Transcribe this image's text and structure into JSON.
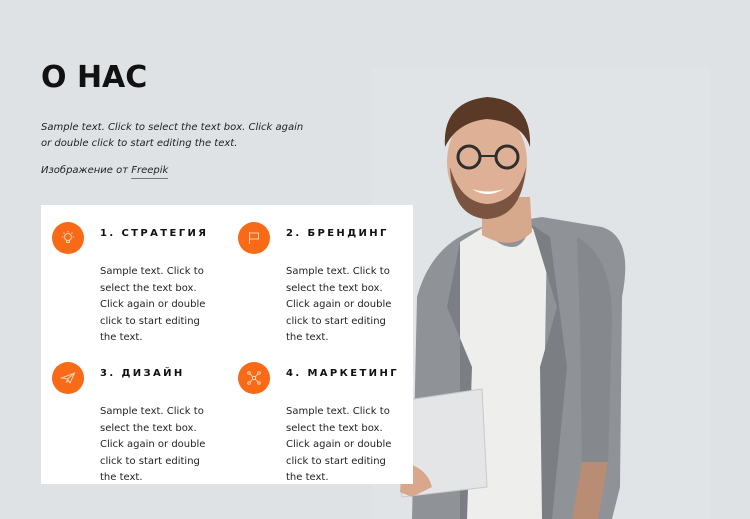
{
  "header": {
    "title": "О НАС",
    "intro": "Sample text. Click to select the text box. Click again or double click to start editing the text.",
    "credit_prefix": "Изображение от ",
    "credit_link": "Freepik"
  },
  "colors": {
    "background": "#dfe2e5",
    "card": "#ffffff",
    "accent": "#f96a17",
    "text": "#111111"
  },
  "features": [
    {
      "title": "1. СТРАТЕГИЯ",
      "icon": "lightbulb-icon",
      "text": "Sample text. Click to select the text box. Click again or double click to start editing the text."
    },
    {
      "title": "2. БРЕНДИНГ",
      "icon": "flag-icon",
      "text": "Sample text. Click to select the text box. Click again or double click to start editing the text."
    },
    {
      "title": "3. ДИЗАЙН",
      "icon": "paper-plane-icon",
      "text": "Sample text. Click to select the text box. Click again or double click to start editing the text."
    },
    {
      "title": "4. МАРКЕТИНГ",
      "icon": "network-icon",
      "text": "Sample text. Click to select the text box. Click again or double click to start editing the text."
    }
  ],
  "image": {
    "description": "Smiling man with glasses in grey blazer holding a laptop"
  }
}
